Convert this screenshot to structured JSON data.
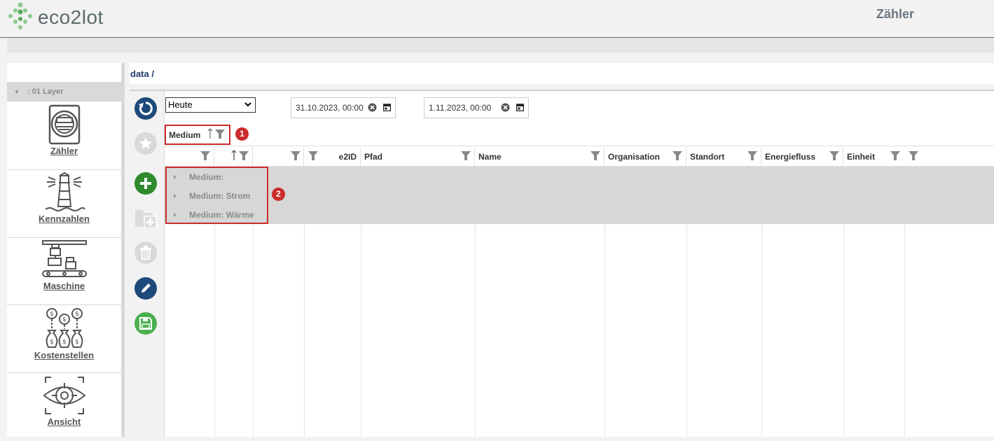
{
  "app": {
    "logo_text": "eco2lot",
    "page_title": "Zähler",
    "breadcrumb": "data /"
  },
  "sidebar": {
    "layer_label": ": 01 Layer",
    "items": [
      {
        "label": "Zähler",
        "icon": "meter-icon"
      },
      {
        "label": "Kennzahlen",
        "icon": "lighthouse-icon"
      },
      {
        "label": "Maschine",
        "icon": "machine-icon"
      },
      {
        "label": "Kostenstellen",
        "icon": "money-bags-icon"
      },
      {
        "label": "Ansicht",
        "icon": "eye-target-icon"
      }
    ]
  },
  "toolbar": {
    "buttons": [
      {
        "name": "refresh-button",
        "color": "#1e4a7a"
      },
      {
        "name": "favorite-button",
        "color": "#d0d0d0"
      },
      {
        "name": "add-button",
        "color": "#2e8b2e"
      },
      {
        "name": "add-folder-button",
        "color": "#d0d0d0"
      },
      {
        "name": "delete-button",
        "color": "#d0d0d0"
      },
      {
        "name": "edit-button",
        "color": "#1e4a7a"
      },
      {
        "name": "save-button",
        "color": "#4caf50"
      }
    ]
  },
  "filters": {
    "period_selected": "Heute",
    "date_from": "31.10.2023, 00:00",
    "date_to": "1.11.2023, 00:00"
  },
  "grouping": {
    "chip_label": "Medium",
    "badge1": "1",
    "badge2": "2"
  },
  "table": {
    "columns": [
      "",
      "",
      "",
      "e2ID",
      "Pfad",
      "Name",
      "Organisation",
      "Standort",
      "Energiefluss",
      "Einheit"
    ],
    "groups": [
      "Medium:",
      "Medium: Strom",
      "Medium: Wärme"
    ]
  },
  "colors": {
    "accent_red": "#cc2b2b",
    "navy": "#1e4a7a",
    "green": "#2e8b2e"
  }
}
